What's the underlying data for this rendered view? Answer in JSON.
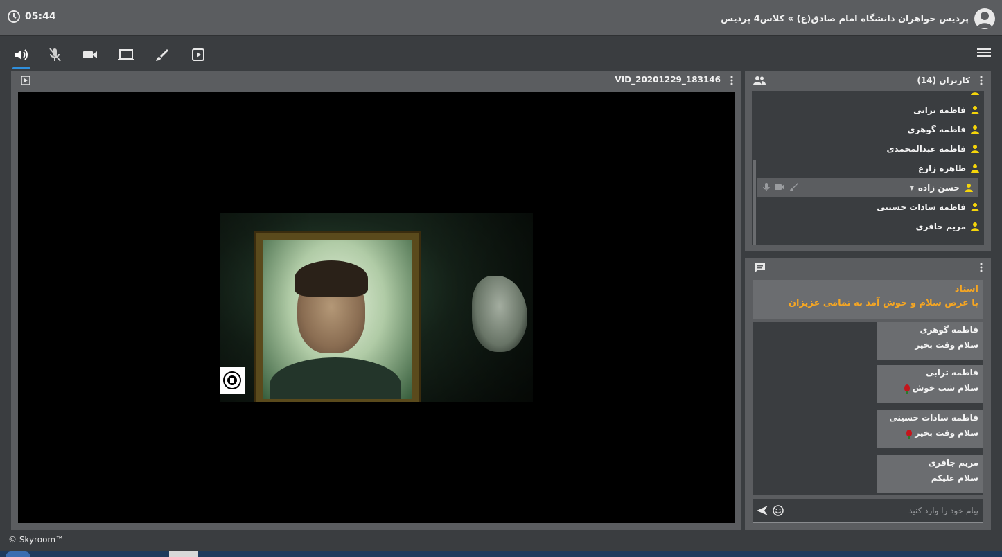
{
  "header": {
    "clock_time": "05:44",
    "room_title": "پردیس خواهران دانشگاه امام صادق(ع) » کلاس4 پردیس"
  },
  "toolbar": {
    "icons": [
      "speaker-icon",
      "mic-off-icon",
      "camera-icon",
      "screen-share-icon",
      "whiteboard-brush-icon",
      "media-play-icon",
      "menu-icon"
    ]
  },
  "video": {
    "title": "VID_20201229_183146"
  },
  "users": {
    "title": "کاربران (14)",
    "list": [
      {
        "name": "فاطمه ترابی"
      },
      {
        "name": "فاطمه گوهری"
      },
      {
        "name": "فاطمه عبدالمحمدی"
      },
      {
        "name": "طاهره زارع"
      },
      {
        "name": "حسن زاده"
      },
      {
        "name": "فاطمه سادات حسینی"
      },
      {
        "name": "مریم جافری"
      }
    ]
  },
  "chat": {
    "pinned": {
      "author": "استاد",
      "text": "با عرض سلام و خوش آمد به تمامی عزیزان"
    },
    "messages": [
      {
        "author": "فاطمه گوهری",
        "text": "سلام وقت بخیر"
      },
      {
        "author": "فاطمه ترابی",
        "text": "سلام شب خوش"
      },
      {
        "author": "فاطمه سادات حسینی",
        "text": "سلام وقت بخیر"
      },
      {
        "author": "مریم جافری",
        "text": "سلام علیکم"
      }
    ],
    "input_placeholder": "پیام خود را وارد کنید"
  },
  "footer": {
    "brand": "© Skyroom™"
  },
  "colors": {
    "accent": "#2f8fdc",
    "user_icon": "#f5d50a",
    "pinned_text": "#f5a623"
  }
}
